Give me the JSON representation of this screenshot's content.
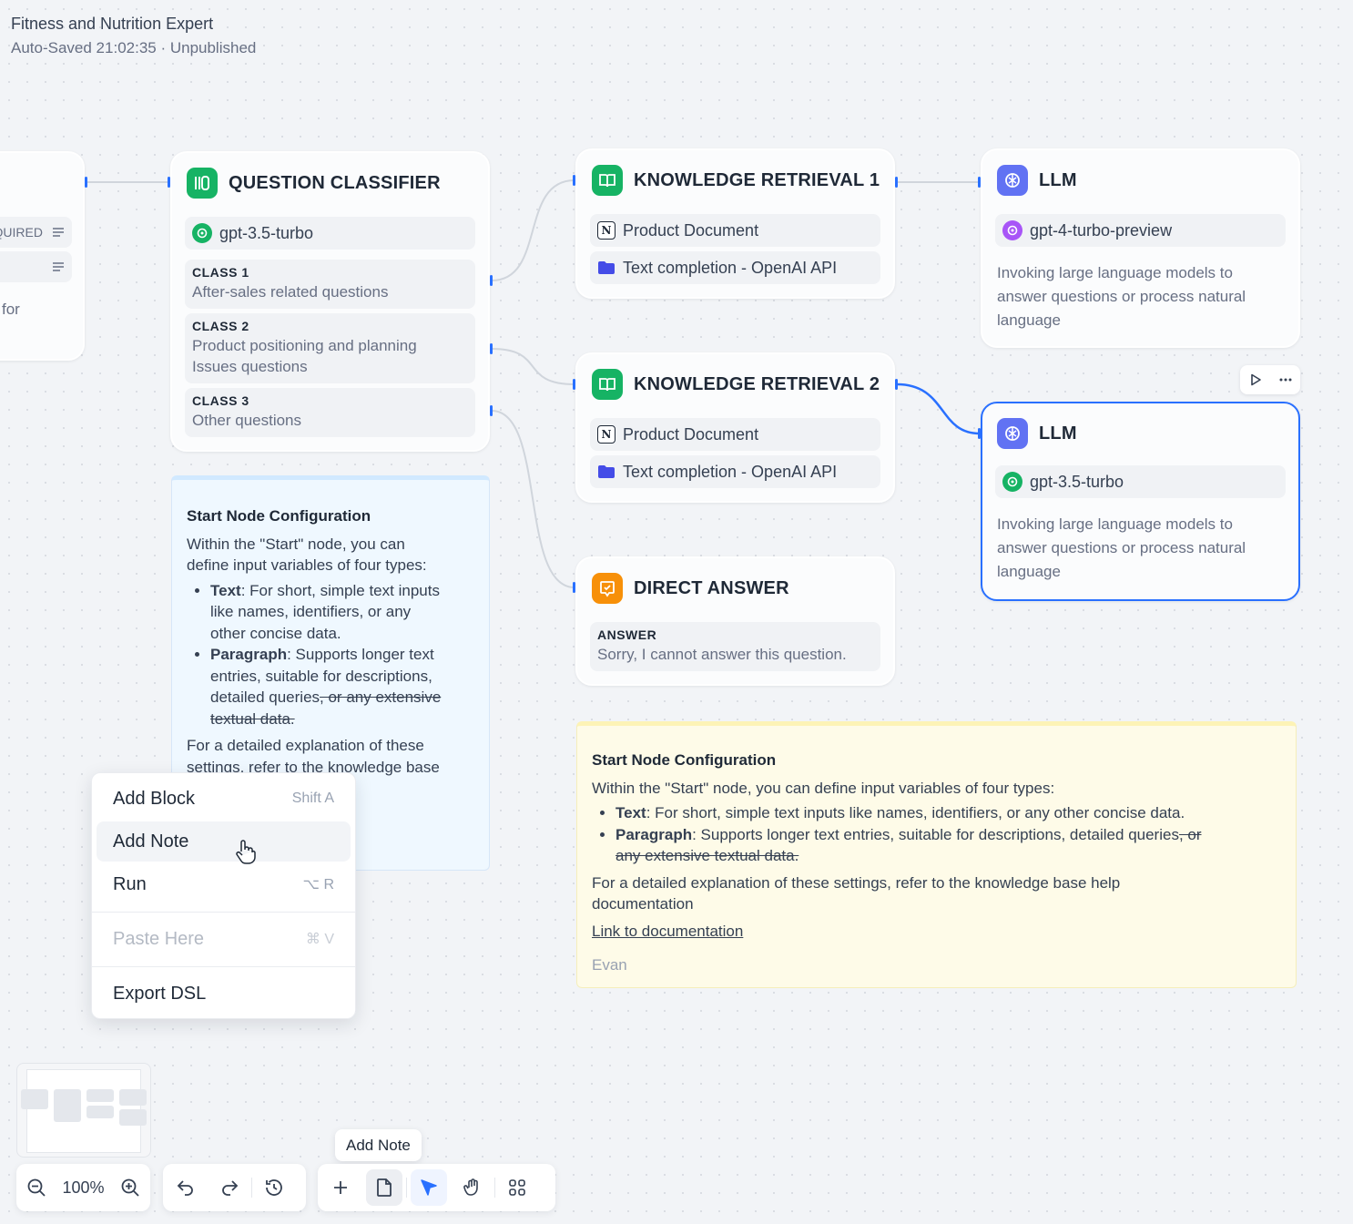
{
  "app": {
    "title": "Fitness and Nutrition Expert",
    "status": "Auto-Saved 21:02:35 · Unpublished"
  },
  "partial_node": {
    "required_label": "QUIRED",
    "text_fragment": "for"
  },
  "question_classifier": {
    "title": "QUESTION CLASSIFIER",
    "model": "gpt-3.5-turbo",
    "classes": [
      {
        "label": "CLASS 1",
        "lines": [
          "After-sales related questions"
        ]
      },
      {
        "label": "CLASS 2",
        "lines": [
          "Product positioning and planning",
          "Issues questions"
        ]
      },
      {
        "label": "CLASS 3",
        "lines": [
          "Other questions"
        ]
      }
    ]
  },
  "knowledge_retrieval_1": {
    "title": "KNOWLEDGE RETRIEVAL 1",
    "items": [
      "Product Document",
      "Text completion - OpenAI API"
    ]
  },
  "knowledge_retrieval_2": {
    "title": "KNOWLEDGE RETRIEVAL 2",
    "items": [
      "Product Document",
      "Text completion - OpenAI API"
    ]
  },
  "direct_answer": {
    "title": "DIRECT ANSWER",
    "answer_label": "ANSWER",
    "answer_text": "Sorry, I cannot answer this question."
  },
  "llm_1": {
    "title": "LLM",
    "model": "gpt-4-turbo-preview",
    "description": [
      "Invoking large language models to",
      "answer questions or process natural",
      "language"
    ]
  },
  "llm_2": {
    "title": "LLM",
    "model": "gpt-3.5-turbo",
    "description": [
      "Invoking large language models to",
      "answer questions or process natural",
      "language"
    ]
  },
  "note_blue": {
    "heading": "Start Node Configuration",
    "intro_lines": [
      "Within the \"Start\" node, you can",
      "define input variables of four types:"
    ],
    "bullets": [
      {
        "term": "Text",
        "lines": [
          ": For short, simple text inputs",
          "like names, identifiers, or any",
          "other concise data."
        ]
      },
      {
        "term": "Paragraph",
        "text": ": Supports longer text",
        "text2": "entries, suitable for descriptions,",
        "text3": "detailed queries",
        "struck": ", or any extensive",
        "struck2": "textual data."
      }
    ],
    "outro_lines": [
      "For a detailed explanation of these",
      "settings, refer to the knowledge base"
    ]
  },
  "note_yellow": {
    "heading": "Start Node Configuration",
    "intro": "Within the \"Start\" node, you can define input variables of four types:",
    "bullet_text_term": "Text",
    "bullet_text": ": For short, simple text inputs like names, identifiers, or any other concise data.",
    "bullet_para_term": "Paragraph",
    "bullet_para": ": Supports longer text entries, suitable for descriptions, detailed queries",
    "bullet_para_struck": ", or",
    "bullet_para_struck2": "any extensive textual data.",
    "outro": "For a detailed explanation of these settings, refer to the knowledge base help documentation",
    "link": "Link to documentation",
    "author": "Evan"
  },
  "context_menu": {
    "items": [
      {
        "label": "Add Block",
        "shortcut": "Shift A"
      },
      {
        "label": "Add Note",
        "shortcut": ""
      },
      {
        "label": "Run",
        "shortcut": "⌥ R"
      },
      {
        "label": "Paste Here",
        "shortcut": "⌘ V"
      },
      {
        "label": "Export DSL",
        "shortcut": ""
      }
    ]
  },
  "zoom": {
    "level": "100%"
  },
  "tooltip": {
    "text": "Add Note"
  },
  "colors": {
    "accent": "#2970ff",
    "classifier_icon": "#16b364",
    "retrieval_icon": "#16b364",
    "answer_icon": "#f79009",
    "llm_icon": "#6172f3",
    "edge": "#d0d5dc"
  },
  "icons": {
    "classifier": "classifier-icon",
    "retrieval": "book-icon",
    "answer": "answer-bubble-icon",
    "llm": "brain-icon",
    "openai": "openai-icon",
    "notion": "notion-icon",
    "folder": "folder-icon"
  }
}
